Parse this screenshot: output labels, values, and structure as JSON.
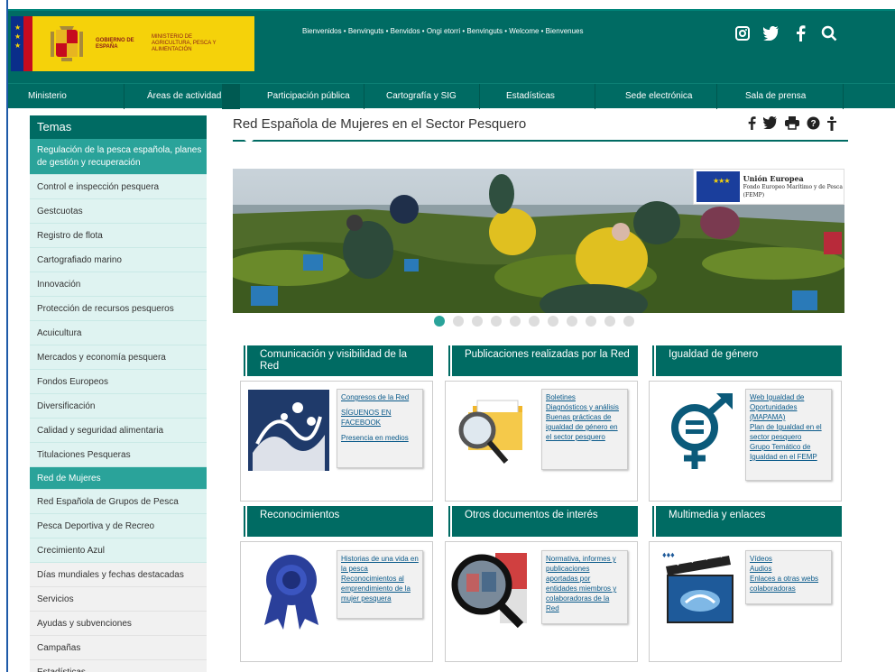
{
  "header": {
    "gov_name": "GOBIERNO DE ESPAÑA",
    "ministry_name": "MINISTERIO DE AGRICULTURA, PESCA Y ALIMENTACIÓN",
    "welcome": "Bienvenidos • Benvinguts • Benvidos • Ongi etorri • Benvinguts • Welcome • Bienvenues",
    "icons": [
      "instagram-icon",
      "twitter-icon",
      "facebook-icon",
      "search-icon"
    ]
  },
  "nav": {
    "items": [
      {
        "label": "Ministerio"
      },
      {
        "label": "Áreas de actividad"
      },
      {
        "label": "Participación pública"
      },
      {
        "label": "Cartografía y SIG"
      },
      {
        "label": "Estadísticas"
      },
      {
        "label": "Sede electrónica"
      },
      {
        "label": "Sala de prensa"
      }
    ],
    "dropdown_symbol": "▾"
  },
  "sidebar": {
    "title": "Temas",
    "items": [
      {
        "label": "Regulación de la pesca española, planes de gestión y recuperación",
        "state": "active"
      },
      {
        "label": "Control e inspección pesquera",
        "state": "light"
      },
      {
        "label": "Gestcuotas",
        "state": "light"
      },
      {
        "label": "Registro de flota",
        "state": "light"
      },
      {
        "label": "Cartografiado marino",
        "state": "light"
      },
      {
        "label": "Innovación",
        "state": "light"
      },
      {
        "label": "Protección de recursos pesqueros",
        "state": "light"
      },
      {
        "label": "Acuicultura",
        "state": "light"
      },
      {
        "label": "Mercados y economía pesquera",
        "state": "light"
      },
      {
        "label": "Fondos Europeos",
        "state": "light"
      },
      {
        "label": "Diversificación",
        "state": "light"
      },
      {
        "label": "Calidad y seguridad alimentaria",
        "state": "light"
      },
      {
        "label": "Titulaciones Pesqueras",
        "state": "light"
      },
      {
        "label": "Red de Mujeres",
        "state": "active"
      },
      {
        "label": "Red Española de Grupos de Pesca",
        "state": "light"
      },
      {
        "label": "Pesca Deportiva y de Recreo",
        "state": "light"
      },
      {
        "label": "Crecimiento Azul",
        "state": "light"
      },
      {
        "label": "Días mundiales y fechas destacadas",
        "state": "grey"
      },
      {
        "label": "Servicios",
        "state": "grey"
      },
      {
        "label": "Ayudas y subvenciones",
        "state": "grey"
      },
      {
        "label": "Campañas",
        "state": "grey"
      },
      {
        "label": "Estadísticas",
        "state": "grey"
      }
    ]
  },
  "main": {
    "title": "Red Española de Mujeres en el Sector Pesquero",
    "tools": [
      "f",
      "🐦",
      "⎙",
      "?",
      "♿"
    ],
    "eu_badge": {
      "title": "Unión Europea",
      "subtitle": "Fondo Europeo Marítimo y de Pesca (FEMP)"
    },
    "slider_dots": 11,
    "slider_active": 0
  },
  "cards": [
    {
      "title": "Comunicación y visibilidad de la Red",
      "image": "wave-poster-image",
      "links": [
        {
          "label": "Congresos de la Red"
        },
        {
          "label": "SÍGUENOS EN FACEBOOK"
        },
        {
          "label": "Presencia en medios"
        }
      ]
    },
    {
      "title": "Publicaciones realizadas por la Red",
      "image": "folder-magnifier-image",
      "links": [
        {
          "label": "Boletines"
        },
        {
          "label": "Diagnósticos y análisis"
        },
        {
          "label": "Buenas prácticas de igualdad de género en el sector pesquero"
        }
      ]
    },
    {
      "title": "Igualdad de género",
      "image": "gender-equality-symbol",
      "links": [
        {
          "label": "Web Igualdad de Oportunidades (MAPAMA)"
        },
        {
          "label": "Plan de Igualdad en el sector pesquero"
        },
        {
          "label": "Grupo Temático de Igualdad en el FEMP"
        }
      ]
    },
    {
      "title": "Reconocimientos",
      "image": "award-ribbon-image",
      "links": [
        {
          "label": "Historias de una vida en la pesca"
        },
        {
          "label": "Reconocimientos al emprendimiento de la mujer pesquera"
        }
      ]
    },
    {
      "title": "Otros documentos de interés",
      "image": "magnifier-photos-image",
      "links": [
        {
          "label": "Normativa, informes y publicaciones aportadas por entidades miembros y colaboradoras de la Red"
        }
      ]
    },
    {
      "title": "Multimedia y enlaces",
      "image": "clapperboard-image",
      "links": [
        {
          "label": "Vídeos"
        },
        {
          "label": "Audios"
        },
        {
          "label": "Enlaces a otras webs colaboradoras"
        }
      ]
    }
  ],
  "colors": {
    "primary": "#006b63",
    "accent": "#2aa39a",
    "sidebar_light": "#dff3f1",
    "link": "#0a5a8a"
  }
}
